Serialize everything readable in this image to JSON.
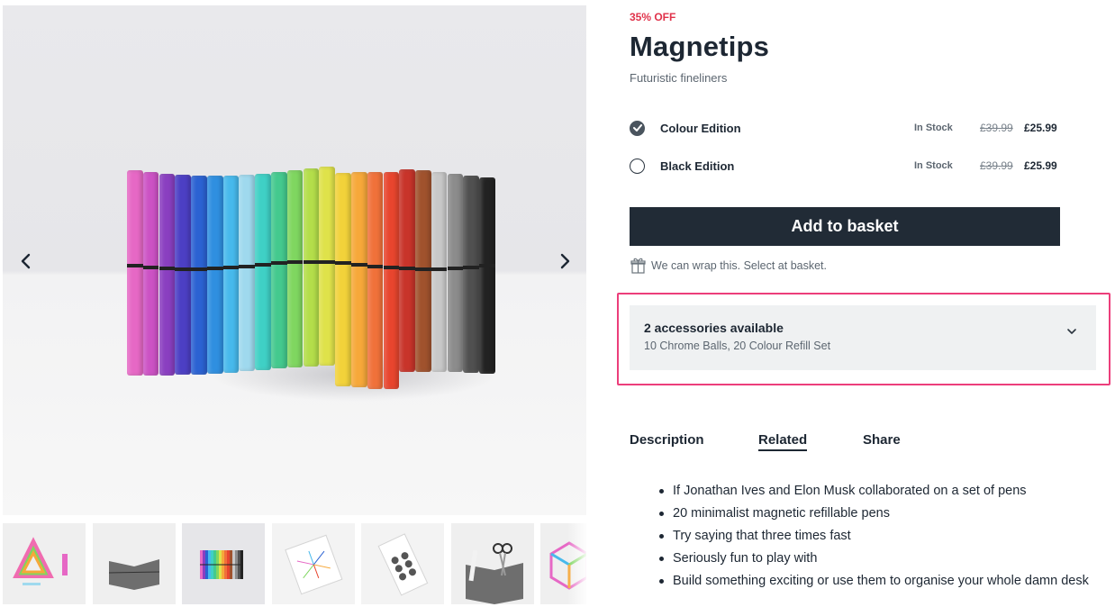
{
  "product": {
    "discount": "35% OFF",
    "title": "Magnetips",
    "subtitle": "Futuristic fineliners"
  },
  "variants": [
    {
      "name": "Colour Edition",
      "stock": "In Stock",
      "old_price": "£39.99",
      "price": "£25.99",
      "selected": true
    },
    {
      "name": "Black Edition",
      "stock": "In Stock",
      "old_price": "£39.99",
      "price": "£25.99",
      "selected": false
    }
  ],
  "basket": {
    "label": "Add to basket"
  },
  "wrap_note": "We can wrap this. Select at basket.",
  "accessories": {
    "title": "2 accessories available",
    "subtitle": "10 Chrome Balls, 20 Colour Refill Set",
    "highlight_color": "#ec3e7b"
  },
  "tabs": [
    {
      "label": "Description",
      "active": false
    },
    {
      "label": "Related",
      "active": true
    },
    {
      "label": "Share",
      "active": false
    }
  ],
  "bullets": [
    "If Jonathan Ives and Elon Musk collaborated on a set of pens",
    "20 minimalist magnetic refillable pens",
    "Try saying that three times fast",
    "Seriously fun to play with",
    "Build something exciting or use them to organise your whole damn desk"
  ],
  "gallery": {
    "prev_icon": "chevron-left-icon",
    "next_icon": "chevron-right-icon",
    "pen_colors": [
      "#e668c5",
      "#cc52c4",
      "#8a3fc0",
      "#4c3fc4",
      "#2b62d2",
      "#2f8fe0",
      "#47b9ec",
      "#9fd9ee",
      "#3fd0c5",
      "#44c98e",
      "#7fd660",
      "#b4de4a",
      "#dfe24a",
      "#f2d23a",
      "#f6a83a",
      "#f0713a",
      "#e8452e",
      "#c8342a",
      "#a0522d",
      "#c8c8c8",
      "#8c8c8c",
      "#505050",
      "#222222"
    ],
    "thumbnails": [
      "triangle-sculpture",
      "folded-pens-grey",
      "rainbow-pens",
      "colour-refill-set",
      "chrome-balls",
      "scissors-holder",
      "cube-sculpture"
    ]
  },
  "colors": {
    "accent": "#e0324a",
    "button": "#212b36",
    "panel": "#eff1f2"
  }
}
